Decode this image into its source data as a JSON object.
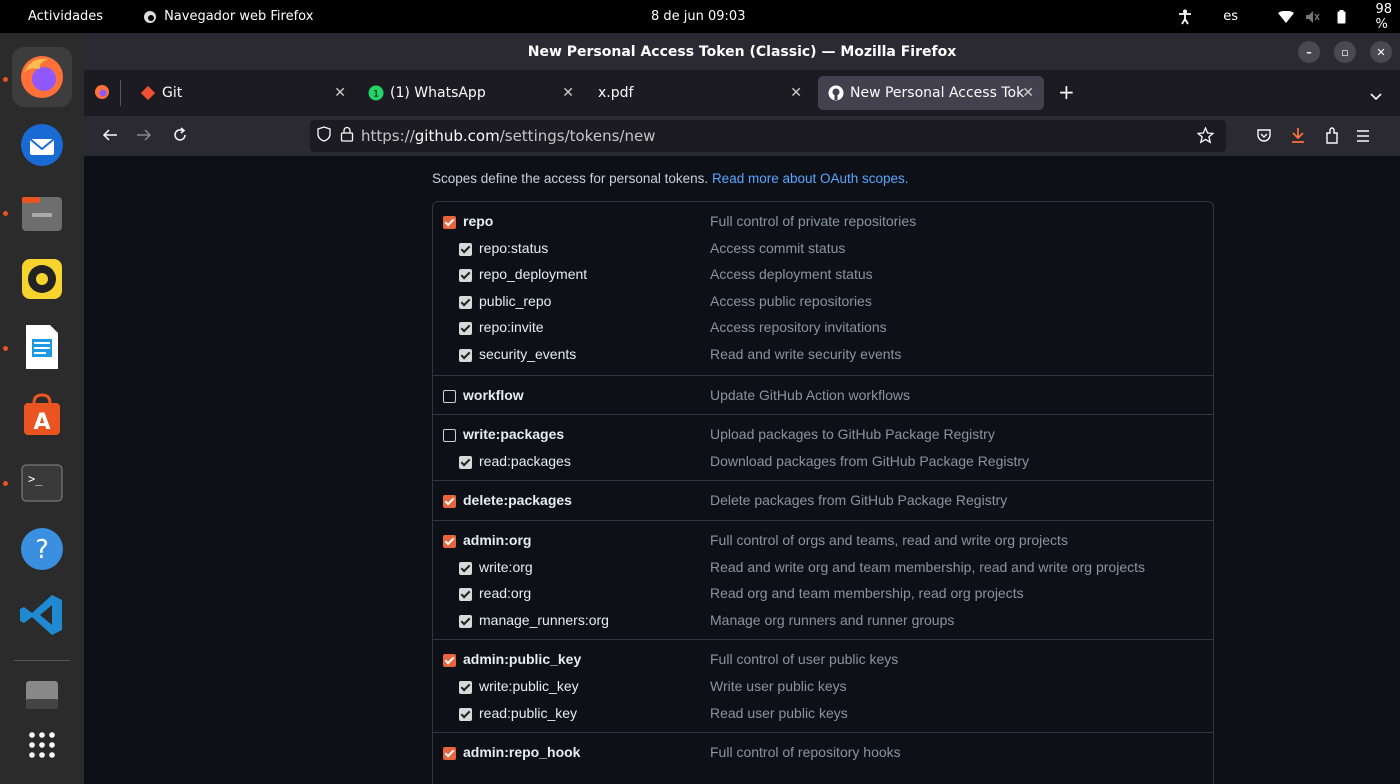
{
  "topbar": {
    "activities": "Actividades",
    "app_name": "Navegador web Firefox",
    "clock": "8 de jun  09:03",
    "language": "es",
    "battery": "98 %"
  },
  "window": {
    "title": "New Personal Access Token (Classic) — Mozilla Firefox"
  },
  "tabs": [
    {
      "label": "Git"
    },
    {
      "label": "(1) WhatsApp"
    },
    {
      "label": "x.pdf"
    },
    {
      "label": "New Personal Access Tok"
    }
  ],
  "urlbar": {
    "prefix": "https://",
    "domain": "github.com",
    "path": "/settings/tokens/new"
  },
  "page": {
    "intro": "Scopes define the access for personal tokens.",
    "intro_link": "Read more about OAuth scopes."
  },
  "scopes": [
    {
      "name": "repo",
      "desc": "Full control of private repositories",
      "checked": true,
      "children": [
        {
          "name": "repo:status",
          "desc": "Access commit status",
          "checked": true
        },
        {
          "name": "repo_deployment",
          "desc": "Access deployment status",
          "checked": true
        },
        {
          "name": "public_repo",
          "desc": "Access public repositories",
          "checked": true
        },
        {
          "name": "repo:invite",
          "desc": "Access repository invitations",
          "checked": true
        },
        {
          "name": "security_events",
          "desc": "Read and write security events",
          "checked": true
        }
      ]
    },
    {
      "name": "workflow",
      "desc": "Update GitHub Action workflows",
      "checked": false,
      "children": []
    },
    {
      "name": "write:packages",
      "desc": "Upload packages to GitHub Package Registry",
      "checked": false,
      "children": [
        {
          "name": "read:packages",
          "desc": "Download packages from GitHub Package Registry",
          "checked": true
        }
      ]
    },
    {
      "name": "delete:packages",
      "desc": "Delete packages from GitHub Package Registry",
      "checked": true,
      "children": []
    },
    {
      "name": "admin:org",
      "desc": "Full control of orgs and teams, read and write org projects",
      "checked": true,
      "children": [
        {
          "name": "write:org",
          "desc": "Read and write org and team membership, read and write org projects",
          "checked": true
        },
        {
          "name": "read:org",
          "desc": "Read org and team membership, read org projects",
          "checked": true
        },
        {
          "name": "manage_runners:org",
          "desc": "Manage org runners and runner groups",
          "checked": true
        }
      ]
    },
    {
      "name": "admin:public_key",
      "desc": "Full control of user public keys",
      "checked": true,
      "children": [
        {
          "name": "write:public_key",
          "desc": "Write user public keys",
          "checked": true
        },
        {
          "name": "read:public_key",
          "desc": "Read user public keys",
          "checked": true
        }
      ]
    },
    {
      "name": "admin:repo_hook",
      "desc": "Full control of repository hooks",
      "checked": true,
      "children": []
    }
  ],
  "dock_apps": [
    "firefox-icon",
    "thunderbird-icon",
    "files-icon",
    "rhythmbox-icon",
    "writer-icon",
    "app-center-icon",
    "terminal-icon",
    "help-icon",
    "vscode-icon",
    "drive-icon",
    "show-apps-icon"
  ],
  "colors": {
    "accent": "#e8643a",
    "link": "#58a6ff",
    "page_bg": "#0d1117"
  }
}
